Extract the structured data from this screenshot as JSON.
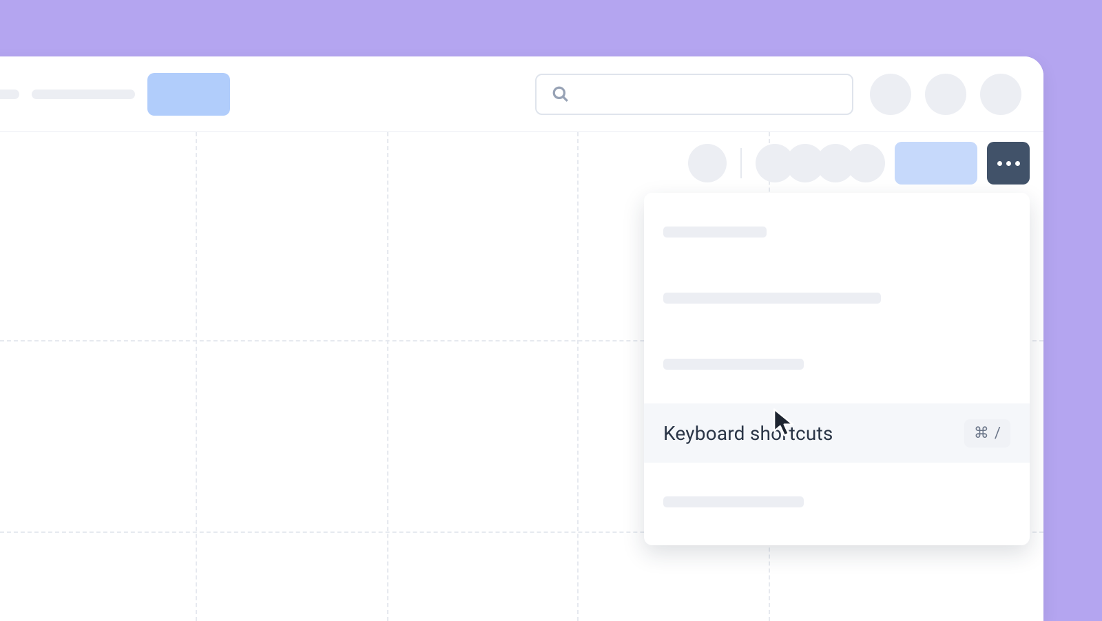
{
  "header": {
    "search_placeholder": ""
  },
  "dropdown": {
    "items": [
      {
        "placeholder_width": 150
      },
      {
        "placeholder_width": 316
      },
      {
        "placeholder_width": 204
      },
      {
        "label": "Keyboard shortcuts",
        "shortcut_symbol": "⌘",
        "shortcut_key": "/"
      },
      {
        "placeholder_width": 204
      }
    ]
  }
}
